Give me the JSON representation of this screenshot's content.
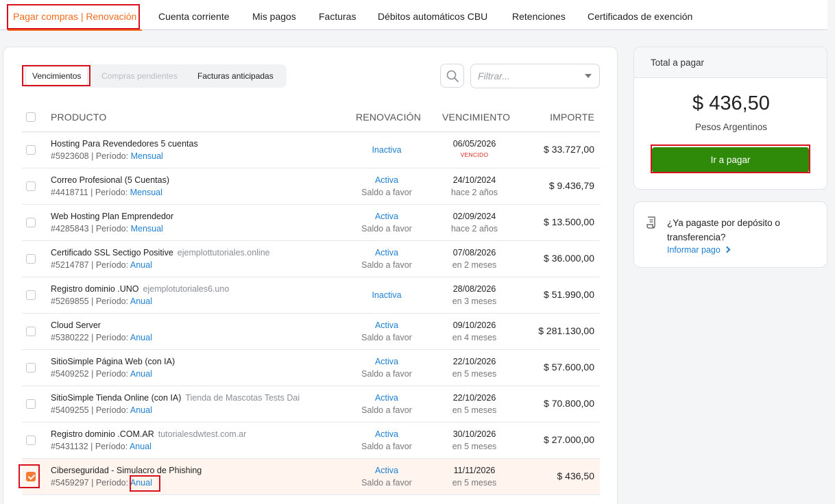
{
  "tabs": [
    {
      "label": "Pagar compras | Renovación",
      "active": true
    },
    {
      "label": "Cuenta corriente"
    },
    {
      "label": "Mis pagos"
    },
    {
      "label": "Facturas"
    },
    {
      "label": "Débitos automáticos CBU"
    },
    {
      "label": "Retenciones"
    },
    {
      "label": "Certificados de exención"
    }
  ],
  "subtabs": {
    "vencimientos": "Vencimientos",
    "pendientes": "Compras pendientes",
    "anticipadas": "Facturas anticipadas"
  },
  "filter": {
    "placeholder": "Filtrar..."
  },
  "table": {
    "headers": {
      "producto": "PRODUCTO",
      "renovacion": "RENOVACIÓN",
      "vencimiento": "VENCIMIENTO",
      "importe": "IMPORTE"
    },
    "rows": [
      {
        "name": "Hosting Para Revendedores 5 cuentas",
        "domain": "",
        "id": "#5923608",
        "periodo_label": "| Período:",
        "periodo": "Mensual",
        "status": "Inactiva",
        "status_sub": "",
        "date": "06/05/2026",
        "date_rel": "",
        "badge": "VENCIDO",
        "amount": "$ 33.727,00",
        "checked": false
      },
      {
        "name": "Correo Profesional (5 Cuentas)",
        "domain": "",
        "id": "#4418711",
        "periodo_label": "| Período:",
        "periodo": "Mensual",
        "status": "Activa",
        "status_sub": "Saldo a favor",
        "date": "24/10/2024",
        "date_rel": "hace 2 años",
        "badge": "",
        "amount": "$ 9.436,79",
        "checked": false
      },
      {
        "name": "Web Hosting Plan Emprendedor",
        "domain": "",
        "id": "#4285843",
        "periodo_label": "| Período:",
        "periodo": "Mensual",
        "status": "Activa",
        "status_sub": "Saldo a favor",
        "date": "02/09/2024",
        "date_rel": "hace 2 años",
        "badge": "",
        "amount": "$ 13.500,00",
        "checked": false
      },
      {
        "name": "Certificado SSL Sectigo Positive",
        "domain": "ejemplottutoriales.online",
        "id": "#5214787",
        "periodo_label": "| Período:",
        "periodo": "Anual",
        "status": "Activa",
        "status_sub": "Saldo a favor",
        "date": "07/08/2026",
        "date_rel": "en 2 meses",
        "badge": "",
        "amount": "$ 36.000,00",
        "checked": false
      },
      {
        "name": "Registro dominio .UNO",
        "domain": "ejemplotutoriales6.uno",
        "id": "#5269855",
        "periodo_label": "| Período:",
        "periodo": "Anual",
        "status": "Inactiva",
        "status_sub": "",
        "date": "28/08/2026",
        "date_rel": "en 3 meses",
        "badge": "",
        "amount": "$ 51.990,00",
        "checked": false
      },
      {
        "name": "Cloud Server",
        "domain": "",
        "id": "#5380222",
        "periodo_label": "| Período:",
        "periodo": "Anual",
        "status": "Activa",
        "status_sub": "Saldo a favor",
        "date": "09/10/2026",
        "date_rel": "en 4 meses",
        "badge": "",
        "amount": "$ 281.130,00",
        "checked": false
      },
      {
        "name": "SitioSimple Página Web (con IA)",
        "domain": "",
        "id": "#5409252",
        "periodo_label": "| Período:",
        "periodo": "Anual",
        "status": "Activa",
        "status_sub": "Saldo a favor",
        "date": "22/10/2026",
        "date_rel": "en 5 meses",
        "badge": "",
        "amount": "$ 57.600,00",
        "checked": false
      },
      {
        "name": "SitioSimple Tienda Online (con IA)",
        "domain": "Tienda de Mascotas Tests Dai",
        "id": "#5409255",
        "periodo_label": "| Período:",
        "periodo": "Anual",
        "status": "Activa",
        "status_sub": "Saldo a favor",
        "date": "22/10/2026",
        "date_rel": "en 5 meses",
        "badge": "",
        "amount": "$ 70.800,00",
        "checked": false
      },
      {
        "name": "Registro dominio .COM.AR",
        "domain": "tutorialesdwtest.com.ar",
        "id": "#5431132",
        "periodo_label": "| Período:",
        "periodo": "Anual",
        "status": "Activa",
        "status_sub": "Saldo a favor",
        "date": "30/10/2026",
        "date_rel": "en 5 meses",
        "badge": "",
        "amount": "$ 27.000,00",
        "checked": false
      },
      {
        "name": "Ciberseguridad - Simulacro de Phishing",
        "domain": "",
        "id": "#5459297",
        "periodo_label": "| Período:",
        "periodo": "Anual",
        "status": "Activa",
        "status_sub": "Saldo a favor",
        "date": "11/11/2026",
        "date_rel": "en 5 meses",
        "badge": "",
        "amount": "$ 436,50",
        "checked": true
      }
    ]
  },
  "summary": {
    "title": "Total a pagar",
    "amount": "$ 436,50",
    "currency": "Pesos Argentinos",
    "pay_label": "Ir a pagar"
  },
  "deposit": {
    "question": "¿Ya pagaste por depósito o transferencia?",
    "link": "Informar pago"
  },
  "colors": {
    "accent": "#f26b1d",
    "link": "#1e7fd1",
    "pay_button": "#2f8a0a",
    "highlight": "#d8101b"
  }
}
